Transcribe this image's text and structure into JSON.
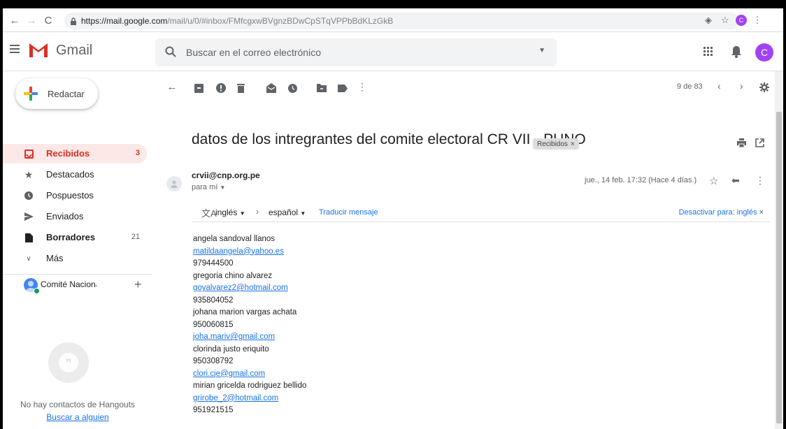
{
  "browser": {
    "url_host": "https://mail.google.com",
    "url_path": "/mail/u/0/#inbox/FMfcgxwBVgnzBDwCpSTqVPPbBdKLzGkB",
    "profile_initial": "C"
  },
  "header": {
    "app_name": "Gmail",
    "search_placeholder": "Buscar en el correo electrónico",
    "avatar_initial": "C"
  },
  "sidebar": {
    "compose_label": "Redactar",
    "items": [
      {
        "label": "Recibidos",
        "count": "3",
        "icon": "inbox-icon",
        "active": true
      },
      {
        "label": "Destacados",
        "count": "",
        "icon": "star-icon"
      },
      {
        "label": "Pospuestos",
        "count": "",
        "icon": "clock-icon"
      },
      {
        "label": "Enviados",
        "count": "",
        "icon": "send-icon"
      },
      {
        "label": "Borradores",
        "count": "21",
        "icon": "draft-icon"
      },
      {
        "label": "Más",
        "count": "",
        "icon": "chevron-down-icon"
      }
    ],
    "hangouts_user": "Comité Nacional",
    "no_contacts": "No hay contactos de Hangouts",
    "find_someone": "Buscar a alguien"
  },
  "toolbar": {
    "pager": "9 de 83"
  },
  "message": {
    "subject": "datos de los intregrantes del comite electoral CR VII - PUNO",
    "label": "Recibidos",
    "sender": "crvii@cnp.org.pe",
    "to": "para mí",
    "date": "jue., 14 feb. 17:32 (Hace 4 días.)",
    "translate": {
      "from": "inglés",
      "to": "español",
      "action": "Traducir mensaje",
      "disable": "Desactivar para: inglés"
    },
    "body": [
      {
        "text": "angela sandoval llanos",
        "link": false
      },
      {
        "text": "matildaangela@yahoo.es",
        "link": true
      },
      {
        "text": "979444500",
        "link": false
      },
      {
        "text": "gregoria chino alvarez",
        "link": false
      },
      {
        "text": "goyalvarez2@hotmail.com",
        "link": true
      },
      {
        "text": "935804052",
        "link": false
      },
      {
        "text": "johana marion vargas achata",
        "link": false
      },
      {
        "text": "950060815",
        "link": false
      },
      {
        "text": "joha.mariv@gmail.com",
        "link": true
      },
      {
        "text": "clorinda justo eriquito",
        "link": false
      },
      {
        "text": "950308792",
        "link": false
      },
      {
        "text": "clori.cje@gmail.com",
        "link": true
      },
      {
        "text": "mirian gricelda rodriguez bellido",
        "link": false
      },
      {
        "text": "grirobe_2@hotmail.com",
        "link": true
      },
      {
        "text": "951921515",
        "link": false
      }
    ]
  },
  "colors": {
    "accent_red": "#d93025",
    "link_blue": "#1a73e8",
    "active_bg": "#fce8e6"
  }
}
